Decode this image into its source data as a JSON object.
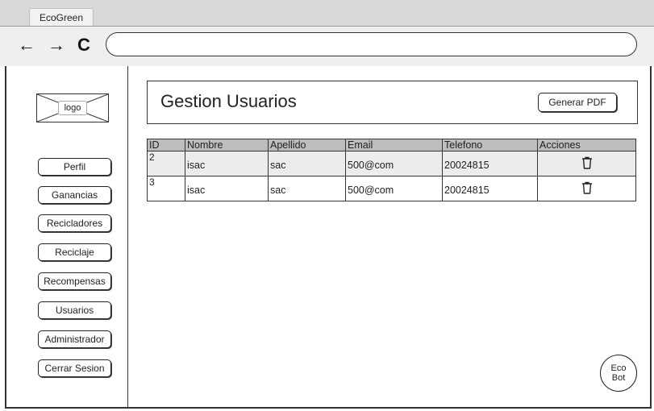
{
  "browser": {
    "tab_title": "EcoGreen",
    "nav": {
      "back": "←",
      "forward": "→",
      "reload": "C"
    },
    "address_value": ""
  },
  "sidebar": {
    "logo_label": "logo",
    "items": [
      {
        "label": "Perfil"
      },
      {
        "label": "Ganancias"
      },
      {
        "label": "Recicladores"
      },
      {
        "label": "Reciclaje"
      },
      {
        "label": "Recompensas"
      },
      {
        "label": "Usuarios"
      },
      {
        "label": "Administrador"
      },
      {
        "label": "Cerrar Sesion"
      }
    ]
  },
  "header": {
    "title": "Gestion Usuarios",
    "pdf_button": "Generar PDF"
  },
  "table": {
    "columns": [
      "ID",
      "Nombre",
      "Apellido",
      "Email",
      "Telefono",
      "Acciones"
    ],
    "rows": [
      {
        "id": "2",
        "nombre": "isac",
        "apellido": "sac",
        "email": "500@com",
        "telefono": "20024815",
        "accion_icon": "trash-icon"
      },
      {
        "id": "3",
        "nombre": "isac",
        "apellido": "sac",
        "email": "500@com",
        "telefono": "20024815",
        "accion_icon": "trash-icon"
      }
    ]
  },
  "chatbot": {
    "line1": "Eco",
    "line2": "Bot"
  },
  "colors": {
    "header_row": "#bdbdbd",
    "stripe_row": "#ececec",
    "browser_bar": "#d9d9d9"
  }
}
